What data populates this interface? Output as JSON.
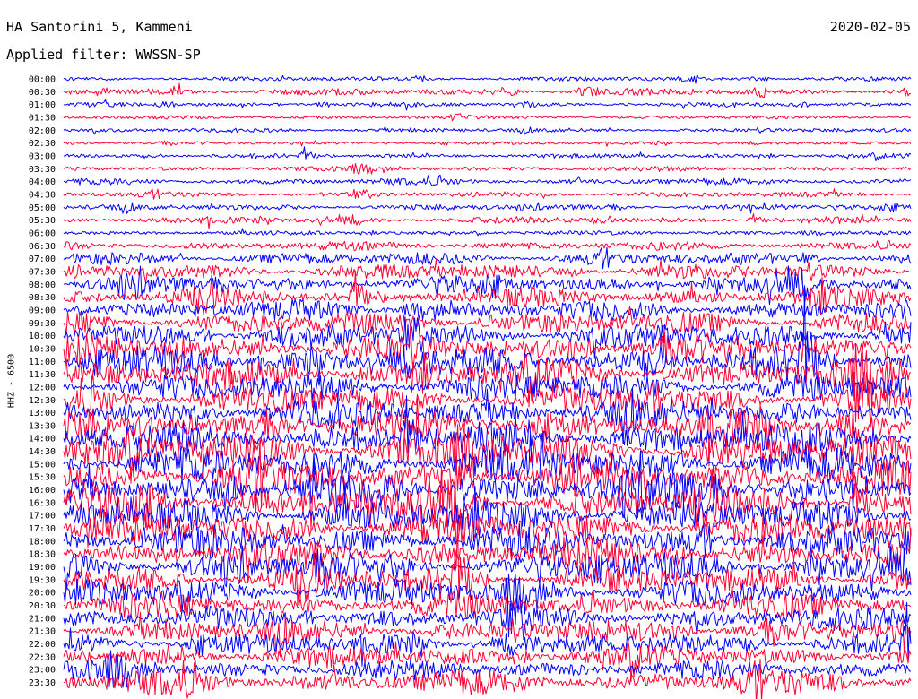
{
  "header": {
    "station": "HA Santorini 5, Kammeni",
    "date": "2020-02-05",
    "filter": "Applied filter: WWSSN-SP"
  },
  "channel_label": "HHZ - 6500",
  "colors": {
    "trace_a": "#0000ff",
    "trace_b": "#ff0033",
    "background": "#ffffff"
  },
  "chart_data": {
    "type": "line",
    "plot_kind": "helicorder",
    "ylabel": "HHZ - 6500",
    "row_labels": [
      "00:00",
      "00:30",
      "01:00",
      "01:30",
      "02:00",
      "02:30",
      "03:00",
      "03:30",
      "04:00",
      "04:30",
      "05:00",
      "05:30",
      "06:00",
      "06:30",
      "07:00",
      "07:30",
      "08:00",
      "08:30",
      "09:00",
      "09:30",
      "10:00",
      "10:30",
      "11:00",
      "11:30",
      "12:00",
      "12:30",
      "13:00",
      "13:30",
      "14:00",
      "14:30",
      "15:00",
      "15:30",
      "16:00",
      "16:30",
      "17:00",
      "17:30",
      "18:00",
      "18:30",
      "19:00",
      "19:30",
      "20:00",
      "20:30",
      "21:00",
      "21:30",
      "22:00",
      "22:30",
      "23:00",
      "23:30"
    ],
    "series": [
      {
        "color": "#0000ff",
        "rows": [
          "00:00",
          "01:00",
          "02:00",
          "03:00",
          "04:00",
          "05:00",
          "06:00",
          "07:00",
          "08:00",
          "09:00",
          "10:00",
          "11:00",
          "12:00",
          "13:00",
          "14:00",
          "15:00",
          "16:00",
          "17:00",
          "18:00",
          "19:00",
          "20:00",
          "21:00",
          "22:00",
          "23:00"
        ]
      },
      {
        "color": "#ff0033",
        "rows": [
          "00:30",
          "01:30",
          "02:30",
          "03:30",
          "04:30",
          "05:30",
          "06:30",
          "07:30",
          "08:30",
          "09:30",
          "10:30",
          "11:30",
          "12:30",
          "13:30",
          "14:30",
          "15:30",
          "16:30",
          "17:30",
          "18:30",
          "19:30",
          "20:30",
          "21:30",
          "22:30",
          "23:30"
        ]
      }
    ],
    "relative_amplitude": [
      2.2,
      4.0,
      2.2,
      1.6,
      2.0,
      1.4,
      2.2,
      2.6,
      3.5,
      2.8,
      3.2,
      3.6,
      2.0,
      5.0,
      7.5,
      9.0,
      10.0,
      11.0,
      12.0,
      14.0,
      16.0,
      17.0,
      18.0,
      18.0,
      18.0,
      18.0,
      18.0,
      19.0,
      20.0,
      22.0,
      22.0,
      22.0,
      22.0,
      21.0,
      20.0,
      20.0,
      19.0,
      18.0,
      18.0,
      17.0,
      16.0,
      15.0,
      14.0,
      14.0,
      13.0,
      13.0,
      12.0,
      15.0
    ]
  }
}
